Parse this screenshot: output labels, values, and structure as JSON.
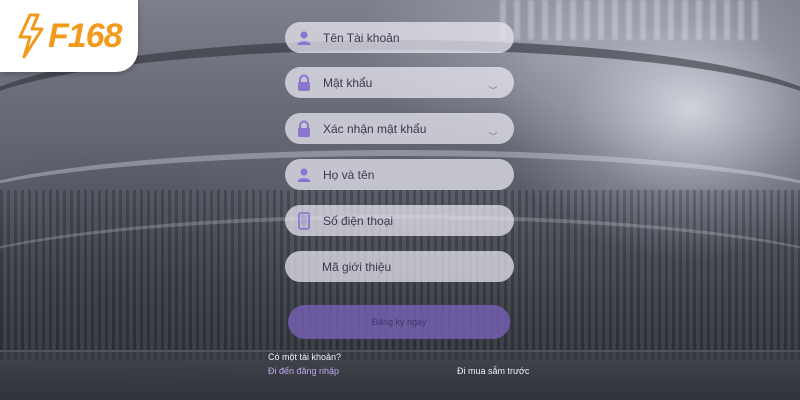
{
  "brand": {
    "logo_text": "F168",
    "logo_color": "#f39a1c"
  },
  "form": {
    "fields": [
      {
        "label": "Tên Tài khoản",
        "icon": "user-icon"
      },
      {
        "label": "Mật khẩu",
        "icon": "lock-icon",
        "toggle_icon": "eye-icon"
      },
      {
        "label": "Xác nhận mật khẩu",
        "icon": "lock-icon",
        "toggle_icon": "eye-icon"
      },
      {
        "label": "Họ và tên",
        "icon": "user-icon"
      },
      {
        "label": "Số điện thoại",
        "icon": "phone-icon"
      },
      {
        "label": "Mã giới thiệu",
        "icon": ""
      }
    ],
    "submit_label": "Đăng ký ngay",
    "submit_color": "#7660b4"
  },
  "footer": {
    "have_account_text": "Có một tài khoản?",
    "login_link": "Đi đến đăng nhập",
    "shop_first_link": "Đi mua sắm trước"
  }
}
